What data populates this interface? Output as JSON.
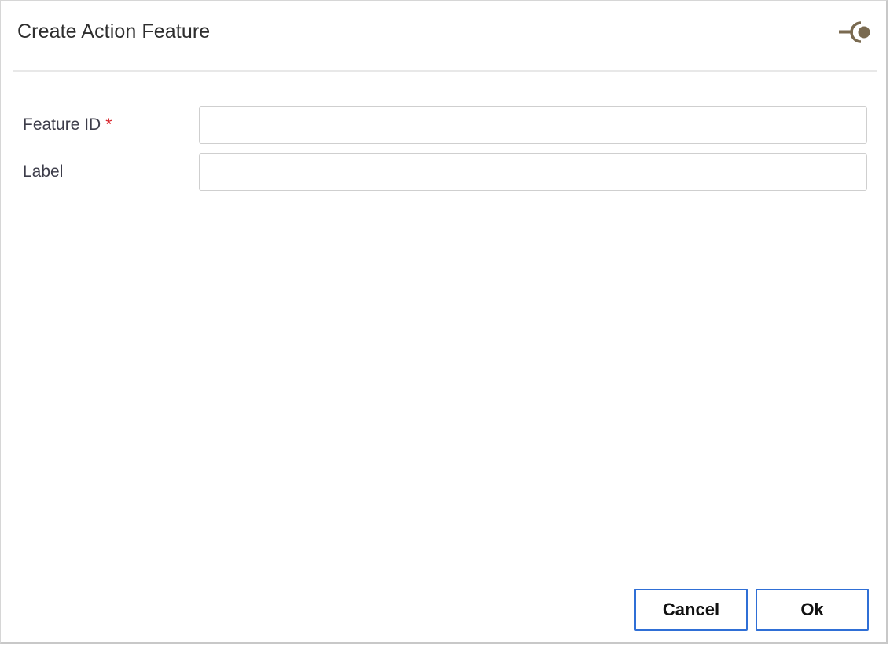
{
  "dialog": {
    "title": "Create Action Feature",
    "header_icon": "action-feature-icon",
    "accent_color": "#7a6a50"
  },
  "form": {
    "feature_id": {
      "label": "Feature ID",
      "required_marker": "*",
      "value": "",
      "placeholder": ""
    },
    "label": {
      "label": "Label",
      "value": "",
      "placeholder": ""
    }
  },
  "buttons": {
    "cancel_label": "Cancel",
    "ok_label": "Ok",
    "border_color": "#2f6fd6"
  }
}
